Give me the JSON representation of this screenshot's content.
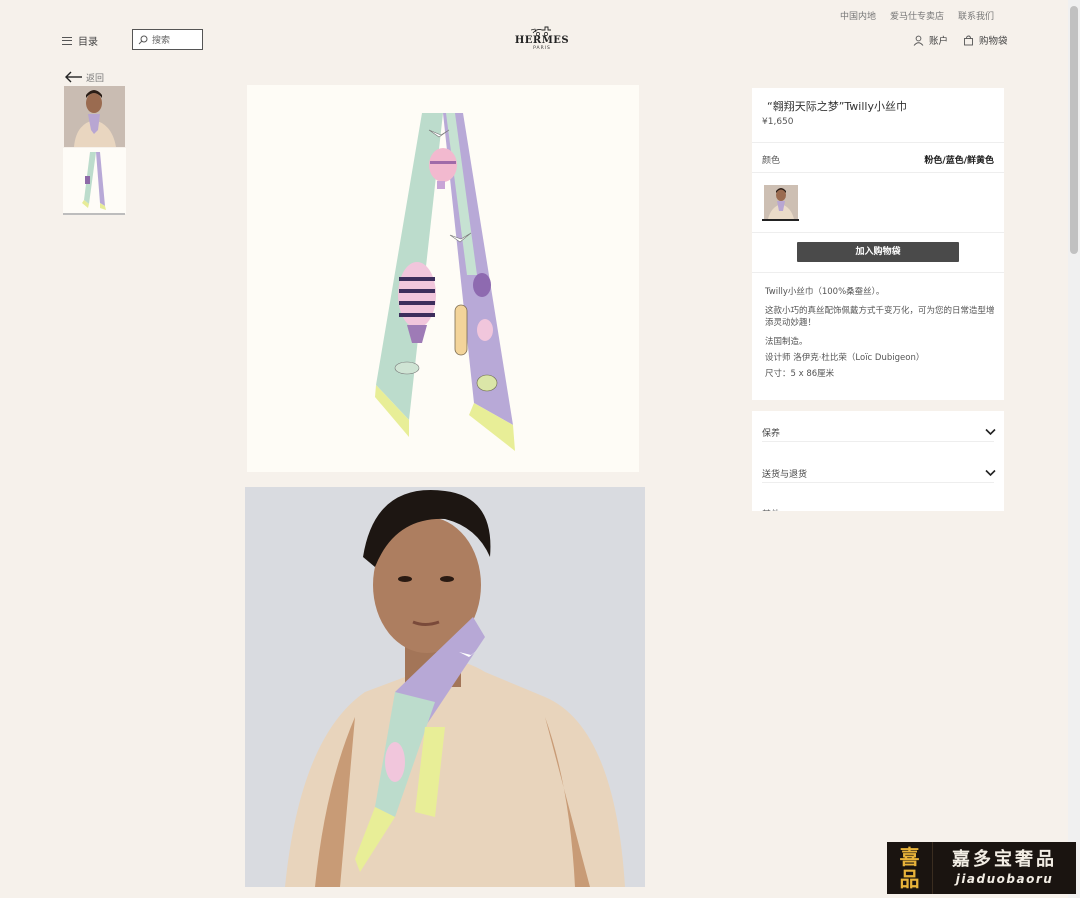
{
  "header": {
    "top_links": [
      "中国内地",
      "爱马仕专卖店",
      "联系我们"
    ],
    "menu_label": "目录",
    "search_placeholder": "搜索",
    "logo_brand": "HERMES",
    "logo_city": "PARIS",
    "account_label": "账户",
    "bag_label": "购物袋"
  },
  "back_label": "返回",
  "product": {
    "title": "“翱翔天际之梦”Twilly小丝巾",
    "price": "¥1,650",
    "color_label": "颜色",
    "color_value": "粉色/蓝色/鲜黄色",
    "add_to_bag": "加入购物袋",
    "description": {
      "line1": "Twilly小丝巾（100%桑蚕丝）。",
      "line2": "这款小巧的真丝配饰佩戴方式千变万化，可为您的日常造型增添灵动妙趣！",
      "line3": "法国制造。",
      "line4": "设计师 洛伊克·杜比荣（Loïc Dubigeon）",
      "line5": "尺寸：5 x 86厘米"
    }
  },
  "accordion": {
    "care": "保养",
    "shipping": "送货与退货",
    "cut_off": "其他"
  },
  "watermark": {
    "logo_top": "喜",
    "logo_bottom": "品",
    "cn": "嘉多宝奢品",
    "en": "jiaduobaoru"
  },
  "colors": {
    "background": "#f6f1eb",
    "button": "#4a4a4a",
    "scarf_mint": "#b9dccb",
    "scarf_lilac": "#b7a8d6",
    "scarf_yellow": "#e8ee97"
  }
}
